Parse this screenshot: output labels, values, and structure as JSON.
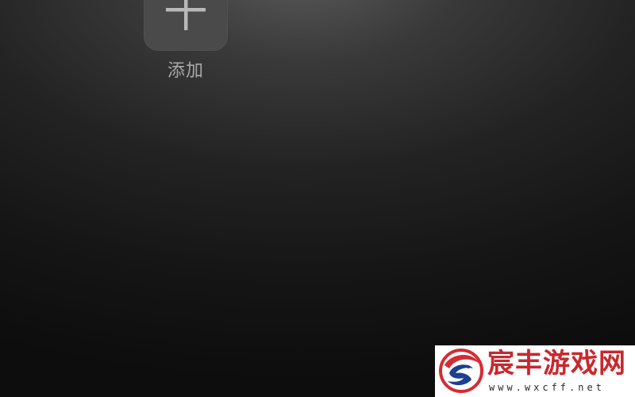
{
  "add_tile": {
    "icon": "plus-icon",
    "label": "添加"
  },
  "watermark": {
    "logo_icon": "dragon-logo-icon",
    "title": "宸丰游戏网",
    "url": "www.wxcff.net",
    "colors": {
      "title": "#c8282e",
      "logo_red": "#d62b33",
      "logo_blue": "#1c3f8f"
    }
  }
}
